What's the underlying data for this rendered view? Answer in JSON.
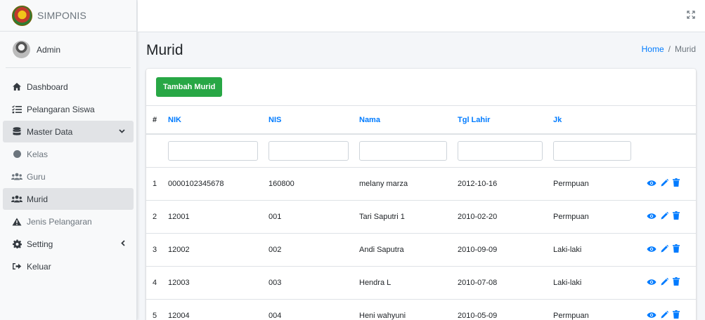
{
  "brand": {
    "name": "SIMPONIS"
  },
  "user": {
    "name": "Admin"
  },
  "sidebar": {
    "items": [
      {
        "label": "Dashboard",
        "icon": "home-icon"
      },
      {
        "label": "Pelangaran Siswa",
        "icon": "list-icon"
      },
      {
        "label": "Master Data",
        "icon": "database-icon"
      },
      {
        "label": "Kelas",
        "icon": "circle-icon"
      },
      {
        "label": "Guru",
        "icon": "users-icon"
      },
      {
        "label": "Murid",
        "icon": "users-icon"
      },
      {
        "label": "Jenis Pelangaran",
        "icon": "warning-icon"
      },
      {
        "label": "Setting",
        "icon": "gear-icon"
      },
      {
        "label": "Keluar",
        "icon": "sign-out-icon"
      }
    ]
  },
  "header": {
    "title": "Murid"
  },
  "breadcrumb": {
    "home": "Home",
    "separator": "/",
    "current": "Murid"
  },
  "toolbar": {
    "add_label": "Tambah Murid"
  },
  "table": {
    "columns": [
      "#",
      "NIK",
      "NIS",
      "Nama",
      "Tgl Lahir",
      "Jk"
    ],
    "rows": [
      {
        "no": "1",
        "nik": "0000102345678",
        "nis": "160800",
        "nama": "melany marza",
        "tgl": "2012-10-16",
        "jk": "Permpuan"
      },
      {
        "no": "2",
        "nik": "12001",
        "nis": "001",
        "nama": "Tari Saputri 1",
        "tgl": "2010-02-20",
        "jk": "Permpuan"
      },
      {
        "no": "3",
        "nik": "12002",
        "nis": "002",
        "nama": "Andi Saputra",
        "tgl": "2010-09-09",
        "jk": "Laki-laki"
      },
      {
        "no": "4",
        "nik": "12003",
        "nis": "003",
        "nama": "Hendra L",
        "tgl": "2010-07-08",
        "jk": "Laki-laki"
      },
      {
        "no": "5",
        "nik": "12004",
        "nis": "004",
        "nama": "Heni wahyuni",
        "tgl": "2010-05-09",
        "jk": "Permpuan"
      }
    ]
  },
  "colors": {
    "accent": "#007bff",
    "success": "#28a745",
    "sidebar_bg": "#f8f9fa",
    "page_bg": "#f4f6f9"
  }
}
